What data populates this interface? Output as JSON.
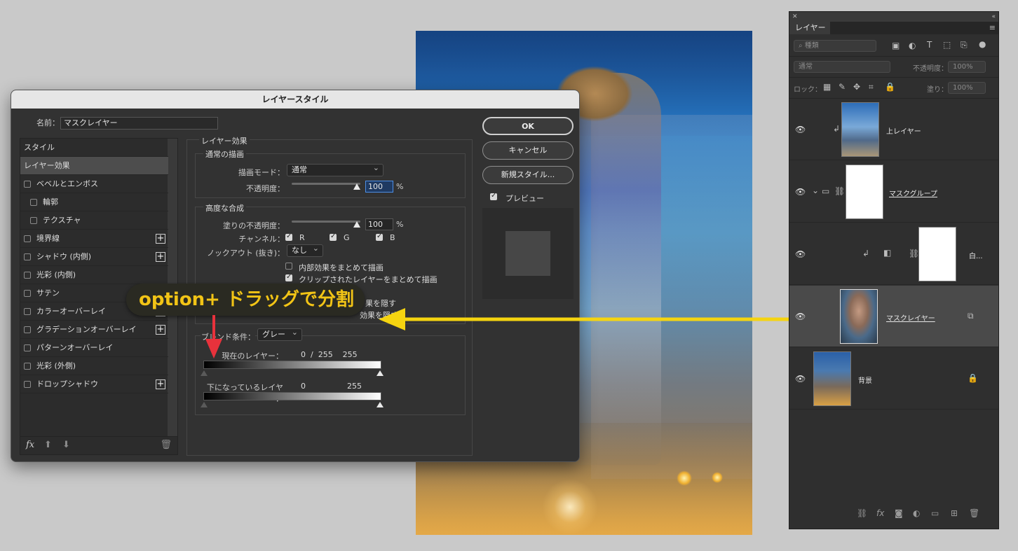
{
  "dialog": {
    "title": "レイヤースタイル",
    "name_label": "名前：",
    "name_value": "マスクレイヤー",
    "style_list": [
      {
        "label": "スタイル",
        "checkbox": false,
        "plus": false,
        "sub": false,
        "selected": false
      },
      {
        "label": "レイヤー効果",
        "checkbox": false,
        "plus": false,
        "sub": false,
        "selected": true
      },
      {
        "label": "ベベルとエンボス",
        "checkbox": true,
        "plus": false,
        "sub": false,
        "selected": false
      },
      {
        "label": "輪郭",
        "checkbox": true,
        "plus": false,
        "sub": true,
        "selected": false
      },
      {
        "label": "テクスチャ",
        "checkbox": true,
        "plus": false,
        "sub": true,
        "selected": false
      },
      {
        "label": "境界線",
        "checkbox": true,
        "plus": true,
        "sub": false,
        "selected": false
      },
      {
        "label": "シャドウ (内側)",
        "checkbox": true,
        "plus": true,
        "sub": false,
        "selected": false
      },
      {
        "label": "光彩 (内側)",
        "checkbox": true,
        "plus": false,
        "sub": false,
        "selected": false
      },
      {
        "label": "サテン",
        "checkbox": true,
        "plus": false,
        "sub": false,
        "selected": false
      },
      {
        "label": "カラーオーバーレイ",
        "checkbox": true,
        "plus": true,
        "sub": false,
        "selected": false
      },
      {
        "label": "グラデーションオーバーレイ",
        "checkbox": true,
        "plus": true,
        "sub": false,
        "selected": false
      },
      {
        "label": "パターンオーバーレイ",
        "checkbox": true,
        "plus": false,
        "sub": false,
        "selected": false
      },
      {
        "label": "光彩 (外側)",
        "checkbox": true,
        "plus": false,
        "sub": false,
        "selected": false
      },
      {
        "label": "ドロップシャドウ",
        "checkbox": true,
        "plus": true,
        "sub": false,
        "selected": false
      }
    ],
    "footer": {
      "fx": "fx",
      "up_icon": "arrow-up-icon",
      "down_icon": "arrow-down-icon",
      "trash_icon": "trash-icon"
    },
    "effects_title": "レイヤー効果",
    "normal": {
      "title": "通常の描画",
      "blend_mode_label": "描画モード：",
      "blend_mode_value": "通常",
      "opacity_label": "不透明度：",
      "opacity_value": "100",
      "unit": "%"
    },
    "advanced": {
      "title": "高度な合成",
      "fill_label": "塗りの不透明度：",
      "fill_value": "100",
      "unit": "%",
      "channel_label": "チャンネル：",
      "channels": [
        "R",
        "G",
        "B"
      ],
      "knockout_label": "ノックアウト (抜き)：",
      "knockout_value": "なし",
      "options": [
        {
          "label": "内部効果をまとめて描画",
          "checked": false
        },
        {
          "label": "クリップされたレイヤーをまとめて描画",
          "checked": true
        }
      ],
      "hidden_option_a": "果を隠す",
      "hidden_option_b": "効果を隠す"
    },
    "blend_if": {
      "label": "ブレンド条件：",
      "value": "グレー",
      "this_layer_label": "現在のレイヤー：",
      "this_layer_values": "0  /  255    255",
      "underlying_label": "下になっているレイヤー：",
      "underlying_low": "0",
      "underlying_high": "255"
    },
    "buttons": {
      "ok": "OK",
      "cancel": "キャンセル",
      "new_style": "新規スタイル..."
    },
    "preview_label": "プレビュー",
    "preview_checked": true
  },
  "callout": {
    "text": "option+ ドラッグで分割",
    "color": "#f2c416",
    "arrow_color": "#f5d410",
    "down_arrow_color": "#e8323c"
  },
  "layers_panel": {
    "tab": "レイヤー",
    "kind_placeholder": "種類",
    "blend_mode": "通常",
    "opacity_label": "不透明度：",
    "opacity_value": "100%",
    "lock_label": "ロック：",
    "fill_label": "塗り：",
    "fill_value": "100%",
    "layers": [
      {
        "name": "上レイヤー",
        "underlined": false,
        "selected": false
      },
      {
        "name": "マスクグループ",
        "underlined": true,
        "selected": false
      },
      {
        "name": "白...",
        "underlined": false,
        "selected": false
      },
      {
        "name": "マスクレイヤー",
        "underlined": true,
        "selected": true
      },
      {
        "name": "背景",
        "underlined": false,
        "selected": false
      }
    ]
  }
}
